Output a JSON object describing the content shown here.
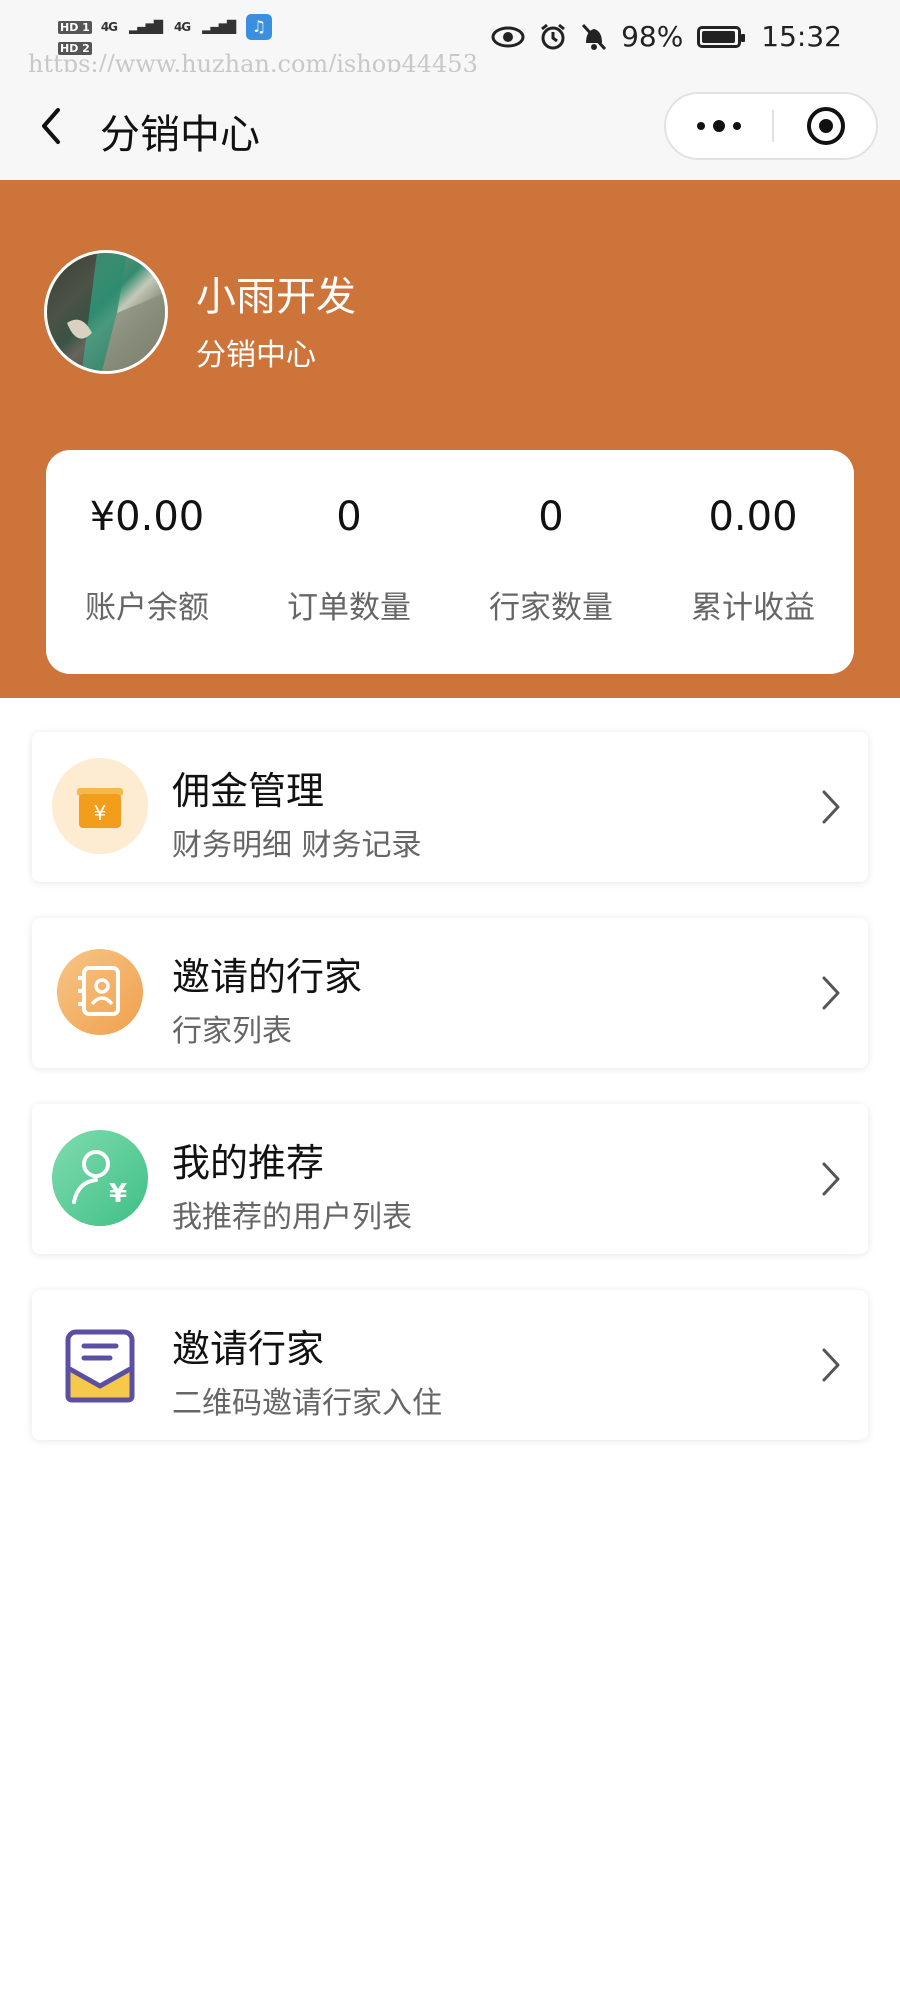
{
  "status_bar": {
    "hd1": "HD 1",
    "hd2": "HD 2",
    "signal1": "4G",
    "signal2": "4G",
    "battery_percent": "98%",
    "battery_level": 0.98,
    "time": "15:32"
  },
  "watermark": "https://www.huzhan.com/ishop44453",
  "nav": {
    "title": "分销中心"
  },
  "profile": {
    "name": "小雨开发",
    "subtitle": "分销中心"
  },
  "stats": [
    {
      "value": "¥0.00",
      "label": "账户余额"
    },
    {
      "value": "0",
      "label": "订单数量"
    },
    {
      "value": "0",
      "label": "行家数量"
    },
    {
      "value": "0.00",
      "label": "累计收益"
    }
  ],
  "menu": [
    {
      "title": "佣金管理",
      "subtitle": "财务明细 财务记录",
      "icon": "commission-wallet-icon"
    },
    {
      "title": "邀请的行家",
      "subtitle": "行家列表",
      "icon": "contacts-book-icon"
    },
    {
      "title": "我的推荐",
      "subtitle": "我推荐的用户列表",
      "icon": "user-yen-icon"
    },
    {
      "title": "邀请行家",
      "subtitle": "二维码邀请行家入住",
      "icon": "envelope-icon"
    }
  ],
  "colors": {
    "header_bg": "#cd743a",
    "page_bg": "#ffffff",
    "nav_bg": "#f7f7f7"
  }
}
